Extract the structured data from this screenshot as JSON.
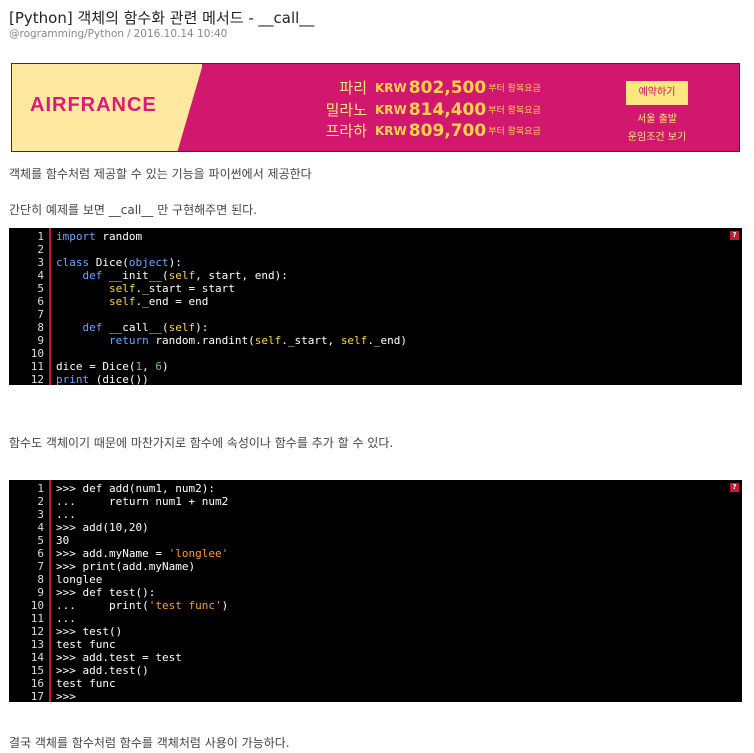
{
  "post": {
    "title": "[Python] 객체의 함수화 관련 메서드 - __call__",
    "category": "@rogramming/Python",
    "date": "2016.10.14 10:40"
  },
  "ad": {
    "brand": "AIRFRANCE",
    "rows": [
      {
        "city": "파리",
        "krw": "KRW",
        "price": "802,500",
        "note": "부터 왕복요금"
      },
      {
        "city": "밀라노",
        "krw": "KRW",
        "price": "814,400",
        "note": "부터 왕복요금"
      },
      {
        "city": "프라하",
        "krw": "KRW",
        "price": "809,700",
        "note": "부터 왕복요금"
      }
    ],
    "book_button": "예약하기",
    "departure": "서울 출발",
    "terms": "운임조건 보기",
    "colors": {
      "pink": "#d2176e",
      "yellow": "#ffe9a0",
      "gold": "#ffd34d"
    }
  },
  "text": {
    "p1": "객체를 함수처럼 제공할 수 있는 기능을 파이썬에서 제공한다",
    "p2": "간단히 예제를 보면 __call__ 만 구현해주면 된다.",
    "p3": "함수도 객체이기 때문에 마찬가지로 함수에 속성이나 함수를 추가 할 수 있다.",
    "p4": "결국 객체를 함수처럼 함수를 객체처럼 사용이 가능하다."
  },
  "code1": {
    "help": "?",
    "lines": [
      [
        {
          "t": "import",
          "c": "kw"
        },
        {
          "t": " random"
        }
      ],
      [],
      [
        {
          "t": "class",
          "c": "kw"
        },
        {
          "t": " Dice("
        },
        {
          "t": "object",
          "c": "bi"
        },
        {
          "t": "):"
        }
      ],
      [
        {
          "t": "    "
        },
        {
          "t": "def",
          "c": "kw"
        },
        {
          "t": " __init__("
        },
        {
          "t": "self",
          "c": "sf"
        },
        {
          "t": ", start, end):"
        }
      ],
      [
        {
          "t": "        "
        },
        {
          "t": "self",
          "c": "sf"
        },
        {
          "t": "._start = start"
        }
      ],
      [
        {
          "t": "        "
        },
        {
          "t": "self",
          "c": "sf"
        },
        {
          "t": "._end = end"
        }
      ],
      [],
      [
        {
          "t": "    "
        },
        {
          "t": "def",
          "c": "kw"
        },
        {
          "t": " __call__("
        },
        {
          "t": "self",
          "c": "sf"
        },
        {
          "t": "):"
        }
      ],
      [
        {
          "t": "        "
        },
        {
          "t": "return",
          "c": "kw"
        },
        {
          "t": " random.randint("
        },
        {
          "t": "self",
          "c": "sf"
        },
        {
          "t": "._start, "
        },
        {
          "t": "self",
          "c": "sf"
        },
        {
          "t": "._end)"
        }
      ],
      [],
      [
        {
          "t": "dice = Dice("
        },
        {
          "t": "1",
          "c": "nm"
        },
        {
          "t": ", "
        },
        {
          "t": "6",
          "c": "nm"
        },
        {
          "t": ")"
        }
      ],
      [
        {
          "t": "print",
          "c": "kw"
        },
        {
          "t": " (dice())"
        }
      ]
    ]
  },
  "code2": {
    "help": "?",
    "lines": [
      [
        {
          "t": ">>> def add(num1, num2):"
        }
      ],
      [
        {
          "t": "...     return num1 + num2"
        }
      ],
      [
        {
          "t": "..."
        }
      ],
      [
        {
          "t": ">>> add(10,20)"
        }
      ],
      [
        {
          "t": "30"
        }
      ],
      [
        {
          "t": ">>> add.myName = "
        },
        {
          "t": "'longlee'",
          "c": "st"
        }
      ],
      [
        {
          "t": ">>> print(add.myName)"
        }
      ],
      [
        {
          "t": "longlee"
        }
      ],
      [
        {
          "t": ">>> def test():"
        }
      ],
      [
        {
          "t": "...     print("
        },
        {
          "t": "'test func'",
          "c": "st"
        },
        {
          "t": ")"
        }
      ],
      [
        {
          "t": "..."
        }
      ],
      [
        {
          "t": ">>> test()"
        }
      ],
      [
        {
          "t": "test func"
        }
      ],
      [
        {
          "t": ">>> add.test = test"
        }
      ],
      [
        {
          "t": ">>> add.test()"
        }
      ],
      [
        {
          "t": "test func"
        }
      ],
      [
        {
          "t": ">>>"
        }
      ]
    ]
  }
}
